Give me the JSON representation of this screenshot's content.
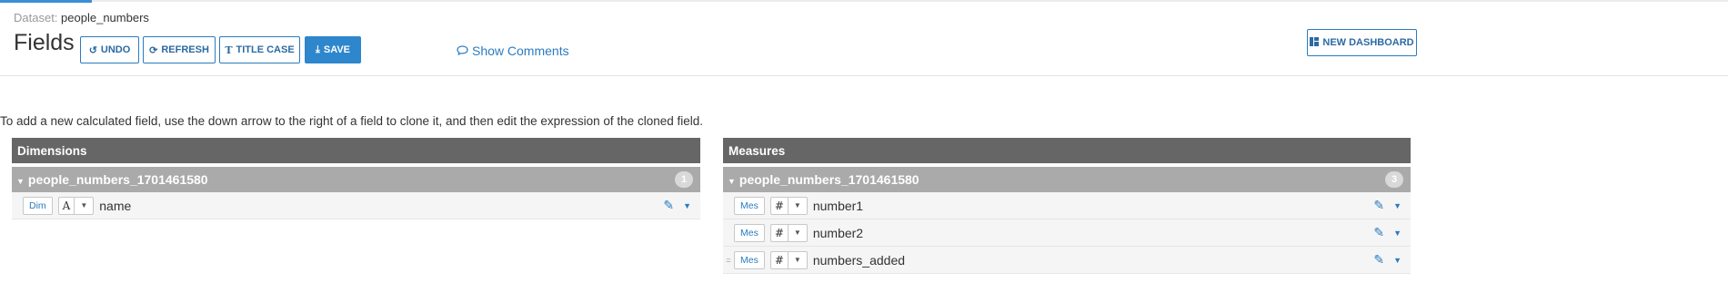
{
  "header": {
    "dataset_label": "Dataset:",
    "dataset_name": "people_numbers",
    "title": "Fields",
    "progress": 0.053
  },
  "toolbar": {
    "undo": {
      "label": "UNDO",
      "icon": "undo-icon"
    },
    "refresh": {
      "label": "REFRESH",
      "icon": "refresh-icon"
    },
    "title_case": {
      "label": "TITLE CASE",
      "icon": "text-icon"
    },
    "save": {
      "label": "SAVE",
      "icon": "download-icon"
    },
    "show_comments": {
      "label": "Show Comments",
      "icon": "comment-icon"
    },
    "new_dashboard": {
      "label": "NEW DASHBOARD",
      "icon": "dashboard-icon"
    }
  },
  "instructions": "To add a new calculated field, use the down arrow to the right of a field to clone it, and then edit the expression of the cloned field.",
  "dimensions": {
    "title": "Dimensions",
    "group": {
      "name": "people_numbers_1701461580",
      "count": "1"
    },
    "fields": [
      {
        "role": "Dim",
        "type_glyph": "A",
        "name": "name"
      }
    ]
  },
  "measures": {
    "title": "Measures",
    "group": {
      "name": "people_numbers_1701461580",
      "count": "3"
    },
    "fields": [
      {
        "role": "Mes",
        "type_glyph": "#",
        "name": "number1"
      },
      {
        "role": "Mes",
        "type_glyph": "#",
        "name": "number2"
      },
      {
        "role": "Mes",
        "type_glyph": "#",
        "name": "numbers_added",
        "handle": "="
      }
    ]
  },
  "colors": {
    "accent": "#2e86cc",
    "panel_header": "#666666",
    "group_header": "#aaaaaa"
  }
}
